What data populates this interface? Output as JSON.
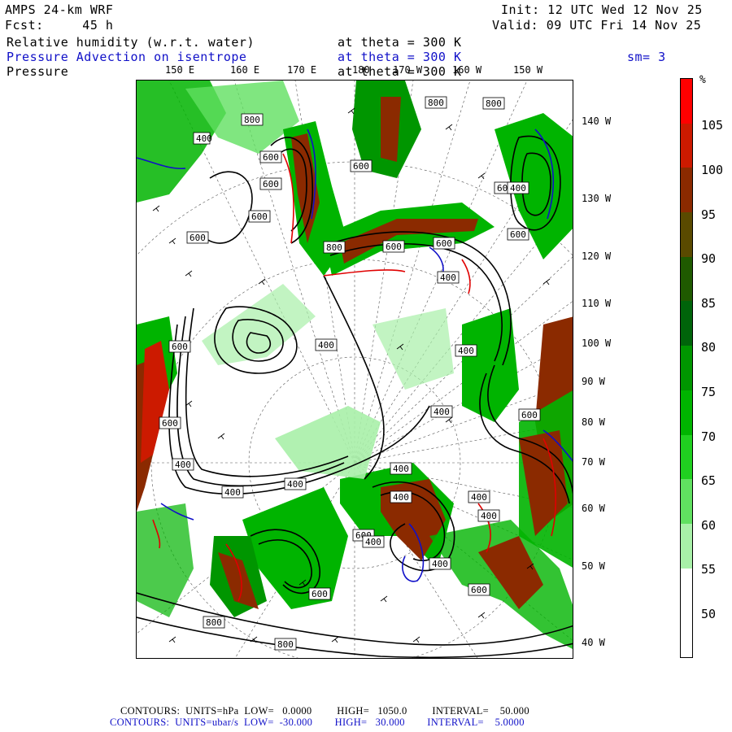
{
  "header": {
    "model": "AMPS 24-km WRF",
    "forecast": "Fcst:     45 h",
    "init": "Init: 12 UTC Wed 12 Nov 25",
    "valid": "Valid: 09 UTC Fri 14 Nov 25",
    "field1_name": "Relative humidity (w.r.t. water)",
    "field1_level": "at theta = 300 K",
    "field2_name": "Pressure Advection on isentrope",
    "field2_level": "at theta = 300 K",
    "field2_smooth": "sm= 3",
    "field3_name": "Pressure",
    "field3_level": "at theta = 300 K"
  },
  "longitude_labels": [
    "150 E",
    "160 E",
    "170 E",
    "180",
    "170 W",
    "160 W",
    "150 W"
  ],
  "latitude_labels": [
    "140 W",
    "130 W",
    "120 W",
    "110 W",
    "100 W",
    "90 W",
    "80 W",
    "70 W",
    "60 W",
    "50 W",
    "40 W"
  ],
  "contour_labels": [
    "800",
    "800",
    "800",
    "400",
    "600",
    "600",
    "600",
    "600",
    "800",
    "600",
    "600",
    "600",
    "400",
    "400",
    "600",
    "400",
    "400",
    "400",
    "600",
    "400",
    "400",
    "400",
    "400",
    "400",
    "600",
    "600",
    "400",
    "600",
    "400",
    "600",
    "400",
    "800",
    "800",
    "600",
    "600",
    "400"
  ],
  "colorbar": {
    "unit": "%",
    "labels": [
      "105",
      "100",
      "95",
      "90",
      "85",
      "80",
      "75",
      "70",
      "65",
      "60",
      "55",
      "50"
    ],
    "colors": [
      "#ff0000",
      "#cc1a00",
      "#8b2a00",
      "#5a4a00",
      "#1f5a00",
      "#00640a",
      "#009600",
      "#00b400",
      "#20d020",
      "#60e060",
      "#a8f0a8",
      "#ffffff",
      "#ffffff"
    ]
  },
  "footer": {
    "line1": "CONTOURS:  UNITS=hPa  LOW=   0.0000         HIGH=   1050.0         INTERVAL=    50.000",
    "line2": "CONTOURS:  UNITS=ubar/s  LOW=  -30.000        HIGH=   30.000        INTERVAL=    5.0000"
  }
}
